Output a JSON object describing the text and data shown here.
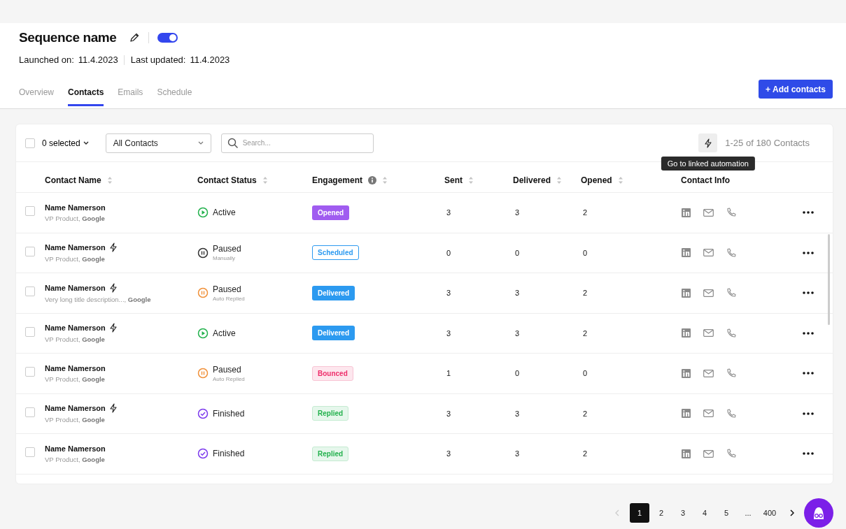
{
  "header": {
    "title": "Sequence name",
    "active": true,
    "launched_label": "Launched on:",
    "launched_date": "11.4.2023",
    "updated_label": "Last updated:",
    "updated_date": "11.4.2023"
  },
  "tabs": [
    {
      "label": "Overview",
      "selected": false
    },
    {
      "label": "Contacts",
      "selected": true
    },
    {
      "label": "Emails",
      "selected": false
    },
    {
      "label": "Schedule",
      "selected": false
    }
  ],
  "add_button": "+ Add contacts",
  "toolbar": {
    "select_all_checked": false,
    "selected_count": "0 selected",
    "filter": "All Contacts",
    "search_placeholder": "Search...",
    "count": "1-25 of 180 Contacts",
    "tooltip": "Go to linked automation"
  },
  "table": {
    "columns": [
      {
        "label": "Contact Name",
        "sortable": true,
        "info": false
      },
      {
        "label": "Contact Status",
        "sortable": true,
        "info": false
      },
      {
        "label": "Engagement",
        "sortable": true,
        "info": true
      },
      {
        "label": "Sent",
        "sortable": true,
        "info": false
      },
      {
        "label": "Delivered",
        "sortable": true,
        "info": false
      },
      {
        "label": "Opened",
        "sortable": true,
        "info": false
      },
      {
        "label": "Contact Info",
        "sortable": false,
        "info": false
      }
    ],
    "rows": [
      {
        "checked": false,
        "name": "Name Namerson",
        "automated": false,
        "subtitle": "VP Product, **Google**",
        "status": {
          "kind": "active",
          "label": "Active"
        },
        "engagement": {
          "kind": "opened",
          "label": "Opened"
        },
        "sent": "3",
        "delivered": "3",
        "opened": "2"
      },
      {
        "checked": false,
        "name": "Name Namerson",
        "automated": true,
        "subtitle": "VP Product, **Google**",
        "status": {
          "kind": "paused-manual",
          "label": "Paused",
          "detail": "Manually"
        },
        "engagement": {
          "kind": "scheduled",
          "label": "Scheduled"
        },
        "sent": "0",
        "delivered": "0",
        "opened": "0"
      },
      {
        "checked": false,
        "name": "Name Namerson",
        "automated": true,
        "subtitle": "Very long title description..., **Google**",
        "status": {
          "kind": "paused-auto",
          "label": "Paused",
          "detail": "Auto Replied"
        },
        "engagement": {
          "kind": "delivered",
          "label": "Delivered"
        },
        "sent": "3",
        "delivered": "3",
        "opened": "2"
      },
      {
        "checked": false,
        "name": "Name Namerson",
        "automated": true,
        "subtitle": "VP Product, **Google**",
        "status": {
          "kind": "active",
          "label": "Active"
        },
        "engagement": {
          "kind": "delivered",
          "label": "Delivered"
        },
        "sent": "3",
        "delivered": "3",
        "opened": "2"
      },
      {
        "checked": false,
        "name": "Name Namerson",
        "automated": false,
        "subtitle": "VP Product, **Google**",
        "status": {
          "kind": "paused-auto",
          "label": "Paused",
          "detail": "Auto Replied"
        },
        "engagement": {
          "kind": "bounced",
          "label": "Bounced"
        },
        "sent": "1",
        "delivered": "0",
        "opened": "0"
      },
      {
        "checked": false,
        "name": "Name Namerson",
        "automated": true,
        "subtitle": "VP Product, **Google**",
        "status": {
          "kind": "finished",
          "label": "Finished"
        },
        "engagement": {
          "kind": "replied",
          "label": "Replied"
        },
        "sent": "3",
        "delivered": "3",
        "opened": "2"
      },
      {
        "checked": false,
        "name": "Name Namerson",
        "automated": false,
        "subtitle": "VP Product, **Google**",
        "status": {
          "kind": "finished",
          "label": "Finished"
        },
        "engagement": {
          "kind": "replied",
          "label": "Replied"
        },
        "sent": "3",
        "delivered": "3",
        "opened": "2"
      }
    ]
  },
  "pagination": {
    "pages": [
      {
        "label": "1",
        "selected": true
      },
      {
        "label": "2",
        "selected": false
      },
      {
        "label": "3",
        "selected": false
      },
      {
        "label": "4",
        "selected": false
      },
      {
        "label": "5",
        "selected": false
      },
      {
        "label": "...",
        "selected": false
      },
      {
        "label": "400",
        "selected": false
      }
    ]
  }
}
